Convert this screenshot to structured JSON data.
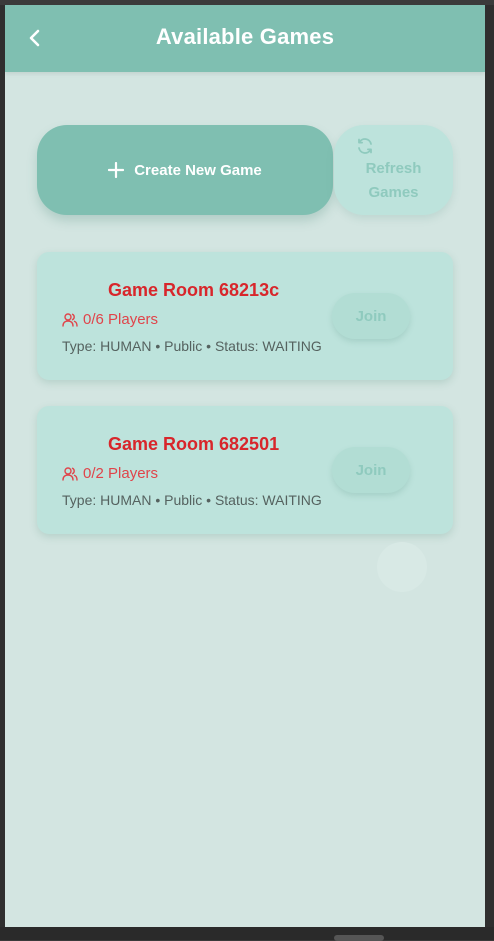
{
  "header": {
    "title": "Available Games",
    "back_icon": "chevron-left-icon"
  },
  "actions": {
    "create_label": "Create New Game",
    "create_icon": "plus-icon",
    "refresh_label_line1": "Refresh",
    "refresh_label_line2": "Games",
    "refresh_icon": "refresh-icon"
  },
  "games": [
    {
      "title": "Game Room 68213c",
      "players": "0/6 Players",
      "meta": "Type: HUMAN • Public • Status: WAITING",
      "join_label": "Join"
    },
    {
      "title": "Game Room 682501",
      "players": "0/2 Players",
      "meta": "Type: HUMAN • Public • Status: WAITING",
      "join_label": "Join"
    }
  ],
  "colors": {
    "background": "#d3e5e1",
    "primary": "#7fbfb1",
    "card": "#bde3dc",
    "title_red": "#d8262b",
    "muted_teal": "#8fcabe"
  }
}
